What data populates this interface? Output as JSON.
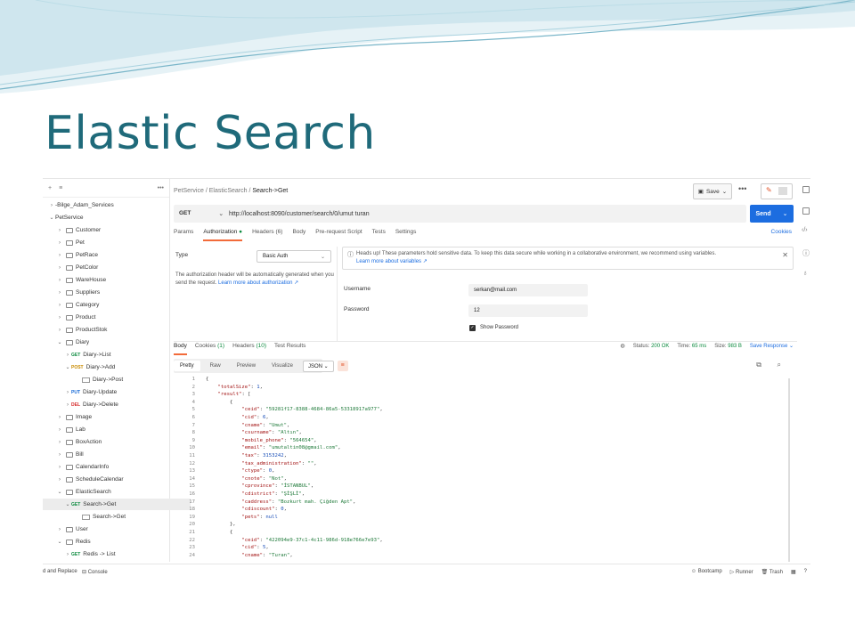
{
  "slide": {
    "title": "Elastic Search"
  },
  "colors": {
    "accent": "#f26b3a",
    "send": "#1c6de0",
    "title": "#1f6a7a"
  },
  "sidebar": {
    "icons": [
      "plus-icon",
      "filter-icon",
      "more-icon"
    ],
    "items": [
      {
        "label": "-Bilge_Adam_Services",
        "type": "root",
        "indent": 0,
        "expanded": false
      },
      {
        "label": "PetService",
        "type": "root",
        "indent": 0,
        "expanded": true
      },
      {
        "label": "Customer",
        "type": "folder",
        "indent": 1
      },
      {
        "label": "Pet",
        "type": "folder",
        "indent": 1
      },
      {
        "label": "PetRace",
        "type": "folder",
        "indent": 1
      },
      {
        "label": "PetColor",
        "type": "folder",
        "indent": 1
      },
      {
        "label": "WareHouse",
        "type": "folder",
        "indent": 1
      },
      {
        "label": "Suppliers",
        "type": "folder",
        "indent": 1
      },
      {
        "label": "Category",
        "type": "folder",
        "indent": 1
      },
      {
        "label": "Product",
        "type": "folder",
        "indent": 1
      },
      {
        "label": "ProductStok",
        "type": "folder",
        "indent": 1
      },
      {
        "label": "Diary",
        "type": "folder",
        "indent": 1,
        "expanded": true
      },
      {
        "label": "Diary->List",
        "type": "request",
        "method": "GET",
        "indent": 2
      },
      {
        "label": "Diary->Add",
        "type": "request",
        "method": "POST",
        "indent": 2,
        "expanded": true
      },
      {
        "label": "Diary->Post",
        "type": "example",
        "indent": 3
      },
      {
        "label": "Diary-Update",
        "type": "request",
        "method": "PUT",
        "indent": 2
      },
      {
        "label": "Diary->Delete",
        "type": "request",
        "method": "DEL",
        "indent": 2
      },
      {
        "label": "Image",
        "type": "folder",
        "indent": 1
      },
      {
        "label": "Lab",
        "type": "folder",
        "indent": 1
      },
      {
        "label": "BoxAction",
        "type": "folder",
        "indent": 1
      },
      {
        "label": "Bill",
        "type": "folder",
        "indent": 1
      },
      {
        "label": "CalendarInfo",
        "type": "folder",
        "indent": 1
      },
      {
        "label": "ScheduleCalendar",
        "type": "folder",
        "indent": 1
      },
      {
        "label": "ElasticSearch",
        "type": "folder",
        "indent": 1,
        "expanded": true
      },
      {
        "label": "Search->Get",
        "type": "request",
        "method": "GET",
        "indent": 2,
        "expanded": true,
        "selected": true
      },
      {
        "label": "Search->Get",
        "type": "example",
        "indent": 3
      },
      {
        "label": "User",
        "type": "folder",
        "indent": 1
      },
      {
        "label": "Redis",
        "type": "folder",
        "indent": 1,
        "expanded": true
      },
      {
        "label": "Redis -> List",
        "type": "request",
        "method": "GET",
        "indent": 2
      }
    ]
  },
  "breadcrumb": {
    "part1": "PetService",
    "sep": "/",
    "part2": "ElasticSearch",
    "current": "Search->Get"
  },
  "toolbar": {
    "save_label": "Save",
    "more": "•••"
  },
  "request": {
    "method": "GET",
    "url": "http://localhost:8090/customer/search/0/umut turan",
    "send_label": "Send"
  },
  "tabs": {
    "items": [
      {
        "label": "Params"
      },
      {
        "label": "Authorization",
        "active": true
      },
      {
        "label": "Headers (6)"
      },
      {
        "label": "Body"
      },
      {
        "label": "Pre-request Script"
      },
      {
        "label": "Tests"
      },
      {
        "label": "Settings"
      }
    ],
    "cookies": "Cookies"
  },
  "auth": {
    "type_label": "Type",
    "type_value": "Basic Auth",
    "note": "The authorization header will be automatically generated when you send the request.",
    "note_link": "Learn more about authorization ↗",
    "info": "Heads up! These parameters hold sensitive data. To keep this data secure while working in a collaborative environment, we recommend using variables.",
    "info_link": "Learn more about variables ↗",
    "username_label": "Username",
    "username_value": "serkan@mail.com",
    "password_label": "Password",
    "password_value": "12",
    "show_password": "Show Password"
  },
  "response": {
    "tabs": [
      "Body",
      "Cookies (1)",
      "Headers (10)",
      "Test Results"
    ],
    "status_label": "Status:",
    "status": "200 OK",
    "time_label": "Time:",
    "time": "65 ms",
    "size_label": "Size:",
    "size": "983 B",
    "save_response": "Save Response",
    "formats": [
      "Pretty",
      "Raw",
      "Preview",
      "Visualize"
    ],
    "format_select": "JSON"
  },
  "code_lines": [
    {
      "n": "1",
      "t": "{"
    },
    {
      "n": "2",
      "t": "    \"totalSize\": 1,"
    },
    {
      "n": "3",
      "t": "    \"result\": ["
    },
    {
      "n": "4",
      "t": "        {"
    },
    {
      "n": "5",
      "t": "            \"ceid\": \"59281f17-8388-4684-86a5-53318917a977\","
    },
    {
      "n": "6",
      "t": "            \"cid\": 6,"
    },
    {
      "n": "7",
      "t": "            \"cname\": \"Umut\","
    },
    {
      "n": "8",
      "t": "            \"csurname\": \"Altın\","
    },
    {
      "n": "9",
      "t": "            \"mobile_phone\": \"564654\","
    },
    {
      "n": "10",
      "t": "            \"email\": \"umutaltin08@gmail.com\","
    },
    {
      "n": "11",
      "t": "            \"tax\": 3153242,"
    },
    {
      "n": "12",
      "t": "            \"tax_administration\": \"\","
    },
    {
      "n": "13",
      "t": "            \"ctype\": 0,"
    },
    {
      "n": "14",
      "t": "            \"cnote\": \"Not\","
    },
    {
      "n": "15",
      "t": "            \"cprovince\": \"İSTANBUL\","
    },
    {
      "n": "16",
      "t": "            \"cdistrict\": \"ŞİŞLİ\","
    },
    {
      "n": "17",
      "t": "            \"caddress\": \"Bozkurt mah. Çiğden Apt\","
    },
    {
      "n": "18",
      "t": "            \"cdiscount\": 0,"
    },
    {
      "n": "19",
      "t": "            \"pets\": null"
    },
    {
      "n": "20",
      "t": "        },"
    },
    {
      "n": "21",
      "t": "        {"
    },
    {
      "n": "22",
      "t": "            \"ceid\": \"422094e9-37c1-4c11-986d-918e766e7e93\","
    },
    {
      "n": "23",
      "t": "            \"cid\": 5,"
    },
    {
      "n": "24",
      "t": "            \"cname\": \"Turan\","
    }
  ],
  "footer": {
    "left": "d and Replace",
    "console": "Console",
    "right": [
      "Bootcamp",
      "Runner",
      "Trash"
    ]
  }
}
